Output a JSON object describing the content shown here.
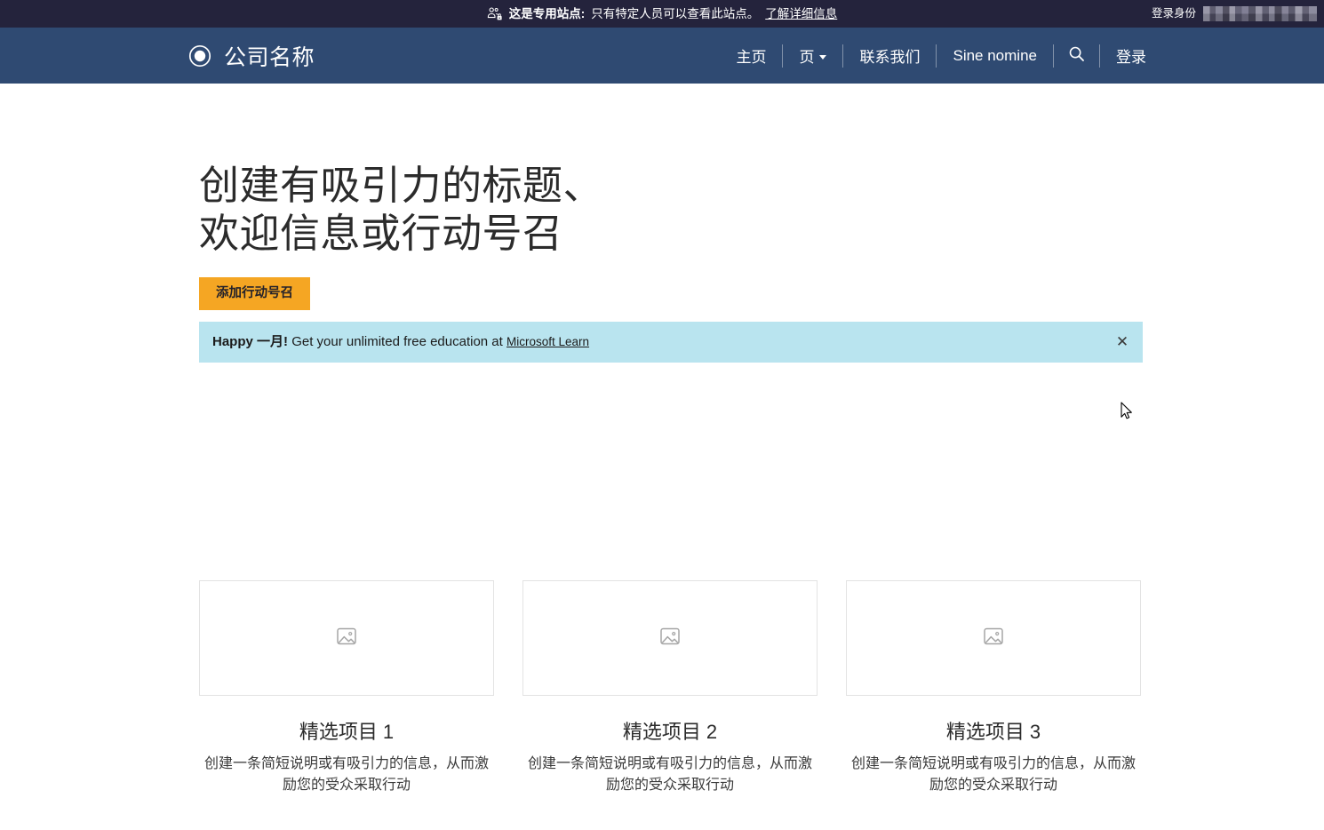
{
  "topbar": {
    "icon": "people-lock-icon",
    "strong_text": "这是专用站点:",
    "text": "只有特定人员可以查看此站点。",
    "link_label": "了解详细信息",
    "signed_in_label": "登录身份",
    "signed_in_user_redacted": "",
    "background": "#24233c"
  },
  "navbar": {
    "logo_icon": "target-circle-logo-icon",
    "brand": "公司名称",
    "background": "#2f4a72",
    "items": [
      {
        "label": "主页",
        "has_caret": false
      },
      {
        "label": "页",
        "has_caret": true
      },
      {
        "label": "联系我们",
        "has_caret": false
      },
      {
        "label": "Sine nomine",
        "has_caret": false
      }
    ],
    "search_icon": "search-icon",
    "signin_label": "登录"
  },
  "hero": {
    "title_line1": "创建有吸引力的标题、",
    "title_line2": "欢迎信息或行动号召",
    "cta_label": "添加行动号召",
    "cta_color": "#f5a623"
  },
  "message_bar": {
    "strong_text": "Happy 一月!",
    "text": "Get your unlimited free education at",
    "link_label": "Microsoft Learn",
    "close_label": "✕",
    "background": "#b9e4ef"
  },
  "cards": [
    {
      "image_placeholder_icon": "image-placeholder-icon",
      "title": "精选项目 1",
      "description": "创建一条简短说明或有吸引力的信息，从而激励您的受众采取行动"
    },
    {
      "image_placeholder_icon": "image-placeholder-icon",
      "title": "精选项目 2",
      "description": "创建一条简短说明或有吸引力的信息，从而激励您的受众采取行动"
    },
    {
      "image_placeholder_icon": "image-placeholder-icon",
      "title": "精选项目 3",
      "description": "创建一条简短说明或有吸引力的信息，从而激励您的受众采取行动"
    }
  ]
}
